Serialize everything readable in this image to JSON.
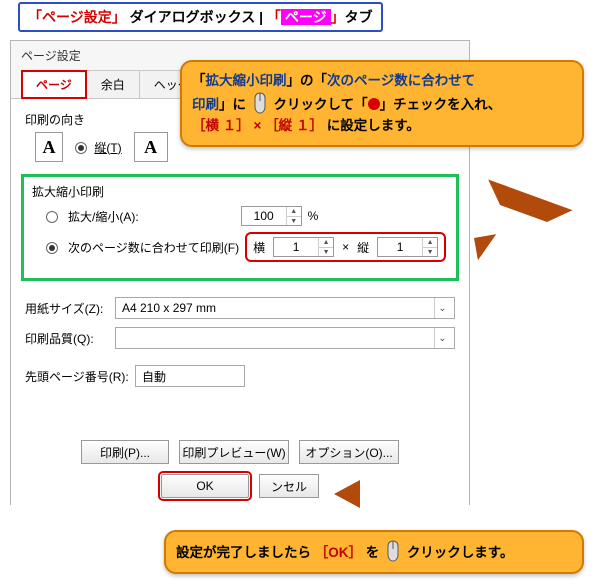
{
  "caption": {
    "text1_quote_open": "「",
    "text1": "ページ設定",
    "text1_quote_close": "」",
    "text2": "ダイアログボックス",
    "sep": " | ",
    "tab_quote_open": "「",
    "tab_badge": "ページ",
    "tab_quote_close": "」",
    "tab_word": "タブ"
  },
  "dialog": {
    "title": "ページ設定",
    "tabs": {
      "page": "ページ",
      "margins": "余白",
      "headerfooter": "ヘッダー/フ"
    },
    "orientation": {
      "label": "印刷の向き",
      "portrait": "縦(T)",
      "landscape_icon": "A"
    },
    "scale": {
      "group_title": "拡大縮小印刷",
      "zoom_label": "拡大/縮小(A):",
      "zoom_value": "100",
      "zoom_unit": "%",
      "fit_label": "次のページ数に合わせて印刷(F)",
      "fit_w_label": "横",
      "fit_w_value": "1",
      "fit_sep": "×",
      "fit_h_label": "縦",
      "fit_h_value": "1"
    },
    "paper_label": "用紙サイズ(Z):",
    "paper_value": "A4 210 x 297 mm",
    "quality_label": "印刷品質(Q):",
    "quality_value": "",
    "firstpage_label": "先頭ページ番号(R):",
    "firstpage_value": "自動",
    "buttons": {
      "print": "印刷(P)...",
      "preview": "印刷プレビュー(W)",
      "options": "オプション(O)...",
      "ok": "OK",
      "cancel": "ンセル"
    }
  },
  "callout1": {
    "l1a": "「",
    "l1b": "拡大縮小印刷",
    "l1c": "」の「",
    "l1d": "次のページ数に合わせて",
    "l2a": "印刷",
    "l2b": "」に",
    "l2c": "クリック",
    "l2d": "して「",
    "l2e": "」チェックを入れ、",
    "l3a": "［横 １］",
    "l3b": "×",
    "l3c": "［縦 １］",
    "l3d": "に設定します。"
  },
  "callout2": {
    "a": "設定が完了しましたら",
    "b": "［OK］",
    "c": "を",
    "d": "クリック",
    "e": "します。"
  }
}
